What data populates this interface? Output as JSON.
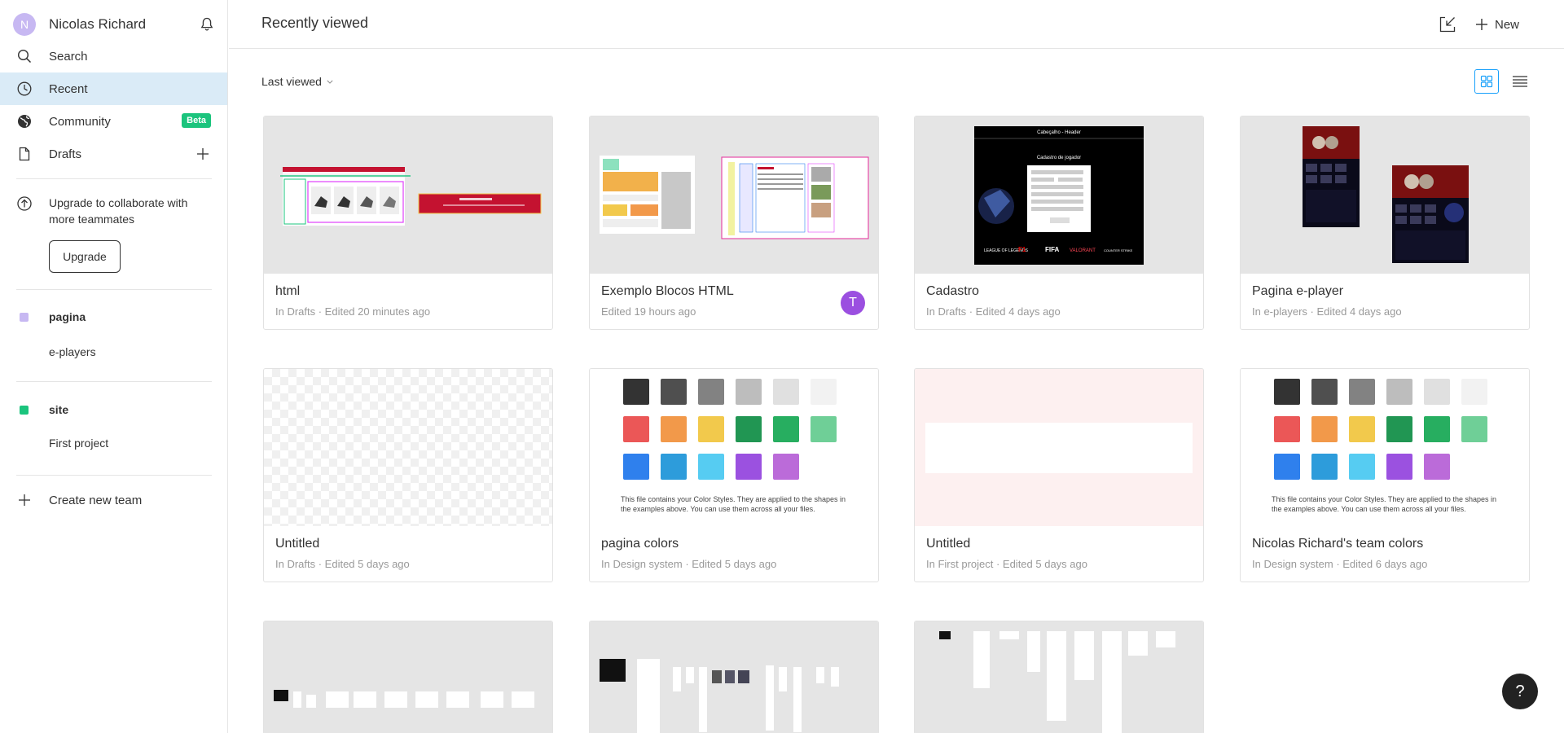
{
  "sidebar": {
    "user": {
      "initial": "N",
      "name": "Nicolas Richard"
    },
    "nav": [
      {
        "label": "Search",
        "icon": "search-icon"
      },
      {
        "label": "Recent",
        "icon": "clock-icon",
        "active": true
      },
      {
        "label": "Community",
        "icon": "globe-icon",
        "badge": "Beta"
      },
      {
        "label": "Drafts",
        "icon": "file-icon"
      }
    ],
    "upgrade": {
      "text": "Upgrade to collaborate with more teammates",
      "button": "Upgrade"
    },
    "teams": [
      {
        "name": "pagina",
        "color": "#c7b8f2",
        "projects": [
          "e-players"
        ]
      },
      {
        "name": "site",
        "color": "#1bc47d",
        "projects": [
          "First project"
        ]
      }
    ],
    "create_team": "Create new team"
  },
  "header": {
    "title": "Recently viewed",
    "new_label": "New"
  },
  "toolbar": {
    "sort_label": "Last viewed"
  },
  "files": [
    {
      "name": "html",
      "meta": "In Drafts · Edited 20 minutes ago"
    },
    {
      "name": "Exemplo Blocos HTML",
      "meta": "Edited 19 hours ago",
      "avatar": "T"
    },
    {
      "name": "Cadastro",
      "meta": "In Drafts · Edited 4 days ago",
      "thumb_header": "Cabeçalho - Header",
      "thumb_form_title": "Cadastro de jogador",
      "thumb_brands": [
        "LEAGUE OF LEGENDS",
        "F1",
        "FIFA",
        "VALORANT",
        "COUNTER STRIKE"
      ]
    },
    {
      "name": "Pagina e-player",
      "meta": "In e-players · Edited 4 days ago"
    },
    {
      "name": "Untitled",
      "meta": "In Drafts · Edited 5 days ago"
    },
    {
      "name": "pagina colors",
      "meta": "In Design system · Edited 5 days ago",
      "thumb_caption": "This file contains your Color Styles. They are applied to the shapes in the examples above. You can use them across all your files."
    },
    {
      "name": "Untitled",
      "meta": "In First project · Edited 5 days ago"
    },
    {
      "name": "Nicolas Richard's team colors",
      "meta": "In Design system · Edited 6 days ago",
      "thumb_caption": "This file contains your Color Styles. They are applied to the shapes in the examples above. You can use them across all your files."
    }
  ],
  "swatches": [
    "#333333",
    "#4f4f4f",
    "#828282",
    "#bdbdbd",
    "#e0e0e0",
    "#f2f2f2",
    "#eb5757",
    "#f2994a",
    "#f2c94c",
    "#219653",
    "#27ae60",
    "#6fcf97",
    "#2f80ed",
    "#2d9cdb",
    "#56ccf2",
    "#9b51e0",
    "#bb6bd9"
  ],
  "help_label": "?"
}
